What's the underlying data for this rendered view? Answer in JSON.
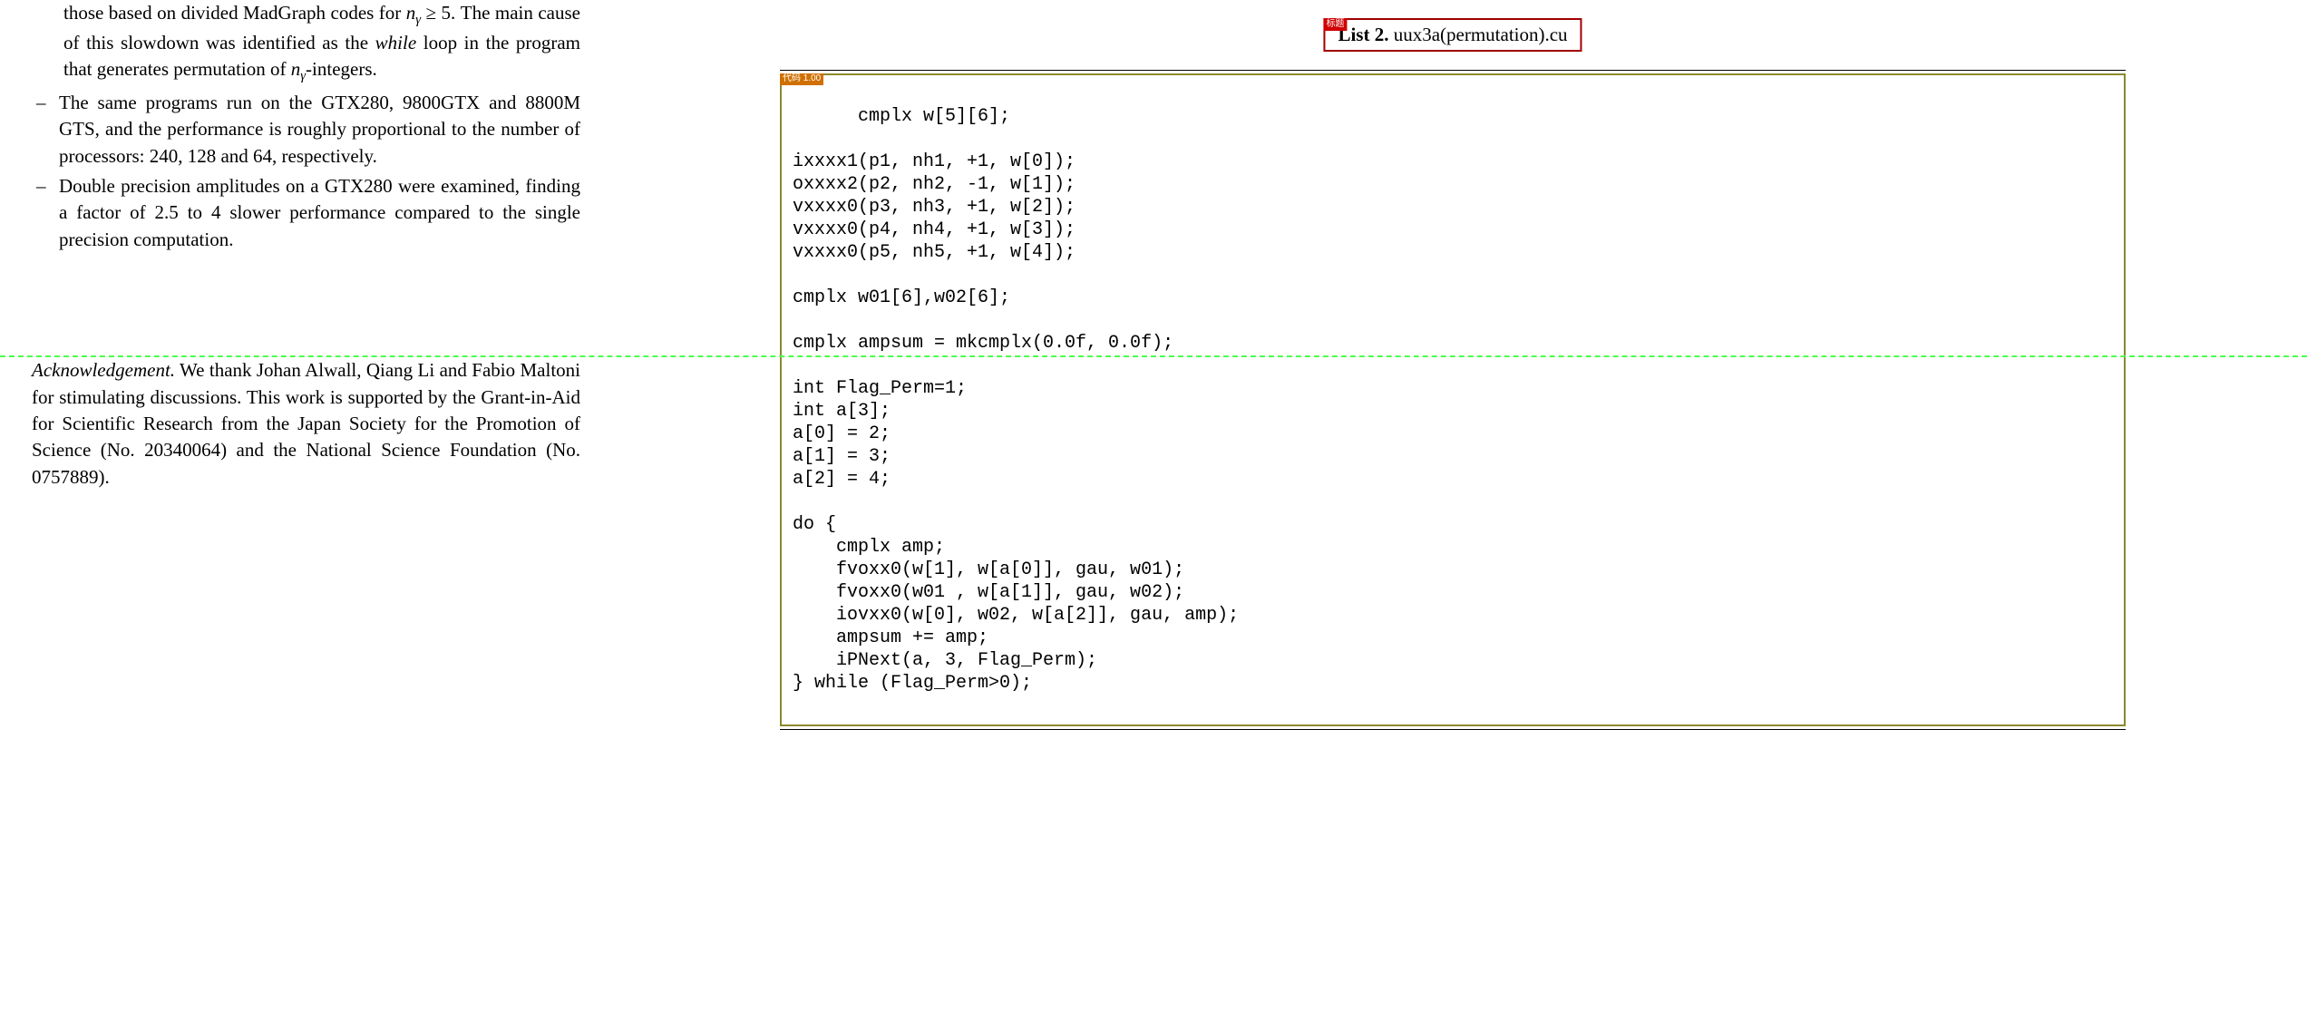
{
  "left": {
    "bullet1_cont1": "those based on divided MadGraph codes for ",
    "bullet1_cont1_math": "n",
    "bullet1_cont1_sub": "γ",
    "bullet1_cont1_tail": " ≥ 5. The main cause of this slowdown was identified as the ",
    "bullet1_while": "while",
    "bullet1_cont2": " loop in the program that generates permutation of ",
    "bullet1_math2": "n",
    "bullet1_sub2": "γ",
    "bullet1_tail2": "-integers.",
    "bullet2": "The same programs run on the GTX280, 9800GTX and 8800M GTS, and the performance is roughly proportional to the number of processors: 240, 128 and 64, respectively.",
    "bullet3": "Double precision amplitudes on a GTX280 were examined, finding a factor of 2.5 to 4 slower performance compared to the single precision computation.",
    "dash": "–",
    "ack_label": "Acknowledgement.",
    "ack_body": " We thank Johan Alwall, Qiang Li and Fabio Maltoni for stimulating discussions. This work is supported by the Grant-in-Aid for Scientific Research from the Japan Society for the Promotion of Science (No. 20340064) and the National Science Foundation (No. 0757889)."
  },
  "right": {
    "list_tag": "标题",
    "list_number": "List 2.",
    "list_filename": " uux3a(permutation).cu",
    "code_tag": "代码 1.00",
    "code": "cmplx w[5][6];\n\nixxxx1(p1, nh1, +1, w[0]);\noxxxx2(p2, nh2, -1, w[1]);\nvxxxx0(p3, nh3, +1, w[2]);\nvxxxx0(p4, nh4, +1, w[3]);\nvxxxx0(p5, nh5, +1, w[4]);\n\ncmplx w01[6],w02[6];\n\ncmplx ampsum = mkcmplx(0.0f, 0.0f);\n\nint Flag_Perm=1;\nint a[3];\na[0] = 2;\na[1] = 3;\na[2] = 4;\n\ndo {\n    cmplx amp;\n    fvoxx0(w[1], w[a[0]], gau, w01);\n    fvoxx0(w01 , w[a[1]], gau, w02);\n    iovxx0(w[0], w02, w[a[2]], gau, amp);\n    ampsum += amp;\n    iPNext(a, 3, Flag_Perm);\n} while (Flag_Perm>0);"
  }
}
